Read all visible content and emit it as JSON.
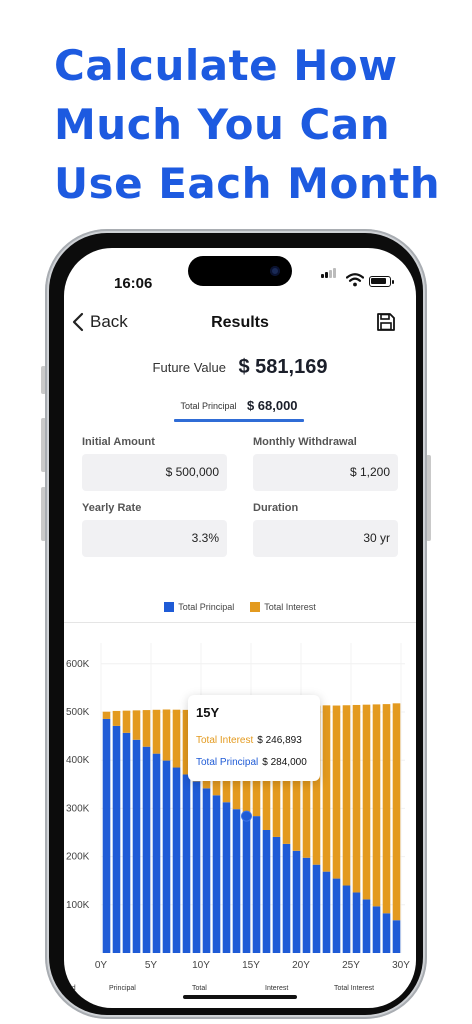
{
  "headline": [
    "Calculate How",
    "Much You Can",
    "Use Each Month"
  ],
  "status": {
    "time": "16:06"
  },
  "nav": {
    "back_label": "Back",
    "title": "Results"
  },
  "summary": {
    "future_value_label": "Future Value",
    "future_value": "$ 581,169"
  },
  "tab": {
    "label": "Total Principal",
    "value": "$ 68,000"
  },
  "inputs": {
    "initial_amount": {
      "label": "Initial Amount",
      "value": "$ 500,000"
    },
    "monthly_withdrawal": {
      "label": "Monthly Withdrawal",
      "value": "$ 1,200"
    },
    "yearly_rate": {
      "label": "Yearly Rate",
      "value": "3.3%"
    },
    "duration": {
      "label": "Duration",
      "value": "30 yr"
    }
  },
  "colors": {
    "accent": "#1d5ae0",
    "principal": "#1f5bd6",
    "interest": "#e39a1f"
  },
  "tooltip": {
    "title": "15Y",
    "interest_label": "Total Interest",
    "interest_value": "$ 246,893",
    "principal_label": "Total Principal",
    "principal_value": "$ 284,000"
  },
  "bottom_labels": [
    "riod",
    "Principal",
    "Total",
    "Interest",
    "Total Interest"
  ],
  "chart_data": {
    "type": "bar",
    "stacked": true,
    "legend": [
      "Total Principal",
      "Total Interest"
    ],
    "x": [
      0,
      1,
      2,
      3,
      4,
      5,
      6,
      7,
      8,
      9,
      10,
      11,
      12,
      13,
      14,
      15,
      16,
      17,
      18,
      19,
      20,
      21,
      22,
      23,
      24,
      25,
      26,
      27,
      28,
      29,
      30
    ],
    "x_tick_labels": [
      "0Y",
      "5Y",
      "10Y",
      "15Y",
      "20Y",
      "25Y",
      "30Y"
    ],
    "y_tick_labels": [
      "100K",
      "200K",
      "300K",
      "400K",
      "500K",
      "600K"
    ],
    "ylim": [
      0,
      600000
    ],
    "series": [
      {
        "name": "Total Principal",
        "values": [
          485600,
          471200,
          456800,
          442400,
          428000,
          413600,
          399200,
          384800,
          370400,
          356000,
          341600,
          327200,
          312800,
          298400,
          284000,
          284000,
          255200,
          240800,
          226400,
          212000,
          197600,
          183200,
          168800,
          154400,
          140000,
          125600,
          111200,
          96800,
          82400,
          68000
        ]
      },
      {
        "name": "Total Interest",
        "values": [
          15000,
          31000,
          46000,
          61000,
          76000,
          91000,
          106000,
          120000,
          134000,
          148000,
          161000,
          175000,
          189000,
          203000,
          217000,
          246893,
          259000,
          273000,
          287000,
          301000,
          316000,
          330000,
          345000,
          359000,
          374000,
          389000,
          404000,
          419000,
          434000,
          450000
        ]
      }
    ]
  }
}
